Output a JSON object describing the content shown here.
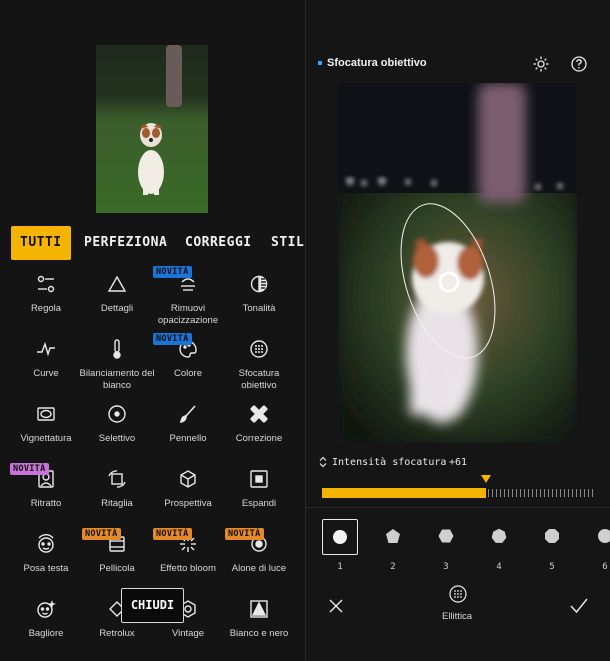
{
  "left_panel": {
    "tabs": [
      {
        "label": "TUTTI",
        "active": true
      },
      {
        "label": "PERFEZIONA",
        "active": false
      },
      {
        "label": "CORREGGI",
        "active": false
      },
      {
        "label": "STILE",
        "active": false
      }
    ],
    "tools": [
      {
        "label": "Regola",
        "icon": "sliders-icon"
      },
      {
        "label": "Dettagli",
        "icon": "triangle-icon"
      },
      {
        "label": "Rimuovi opacizzazione",
        "icon": "haze-icon",
        "badge": "NOVITÀ"
      },
      {
        "label": "Tonalità",
        "icon": "tonal-circle-icon"
      },
      {
        "label": "Curve",
        "icon": "curve-icon"
      },
      {
        "label": "Bilanciamento del bianco",
        "icon": "thermometer-icon"
      },
      {
        "label": "Colore",
        "icon": "palette-icon",
        "badge": "NOVITÀ"
      },
      {
        "label": "Sfocatura obiettivo",
        "icon": "lens-blur-icon"
      },
      {
        "label": "Vignettatura",
        "icon": "vignette-icon"
      },
      {
        "label": "Selettivo",
        "icon": "target-icon"
      },
      {
        "label": "Pennello",
        "icon": "brush-icon"
      },
      {
        "label": "Correzione",
        "icon": "bandage-icon"
      },
      {
        "label": "Ritratto",
        "icon": "portrait-icon",
        "badge": "NOVITÀ"
      },
      {
        "label": "Ritaglia",
        "icon": "crop-rotate-icon"
      },
      {
        "label": "Prospettiva",
        "icon": "cube-icon"
      },
      {
        "label": "Espandi",
        "icon": "expand-icon"
      },
      {
        "label": "Posa testa",
        "icon": "face-pose-icon"
      },
      {
        "label": "Pellicola",
        "icon": "film-icon",
        "badge": "NOVITÀ"
      },
      {
        "label": "Effetto bloom",
        "icon": "bloom-icon",
        "badge": "NOVITÀ"
      },
      {
        "label": "Alone di luce",
        "icon": "glow-icon",
        "badge": "NOVITÀ"
      },
      {
        "label": "Bagliore",
        "icon": "sparkle-face-icon"
      },
      {
        "label": "Retrolux",
        "icon": "retrolux-icon"
      },
      {
        "label": "Vintage",
        "icon": "vintage-icon"
      },
      {
        "label": "Bianco e nero",
        "icon": "bw-icon"
      }
    ],
    "close_button": "CHIUDI"
  },
  "right_panel": {
    "title": "Sfocatura obiettivo",
    "slider": {
      "label": "Intensità sfocatura",
      "value": "+61",
      "fill_fraction": 0.61
    },
    "shapes": [
      "1",
      "2",
      "3",
      "4",
      "5",
      "6"
    ],
    "shape_selected": "1",
    "mode_label": "Ellittica"
  },
  "colors": {
    "accent": "#f5b400",
    "badge_blue": "#1e73d8",
    "badge_pink": "#c873d8",
    "badge_orange": "#e58a2a",
    "title_dot": "#3aa0ff"
  }
}
